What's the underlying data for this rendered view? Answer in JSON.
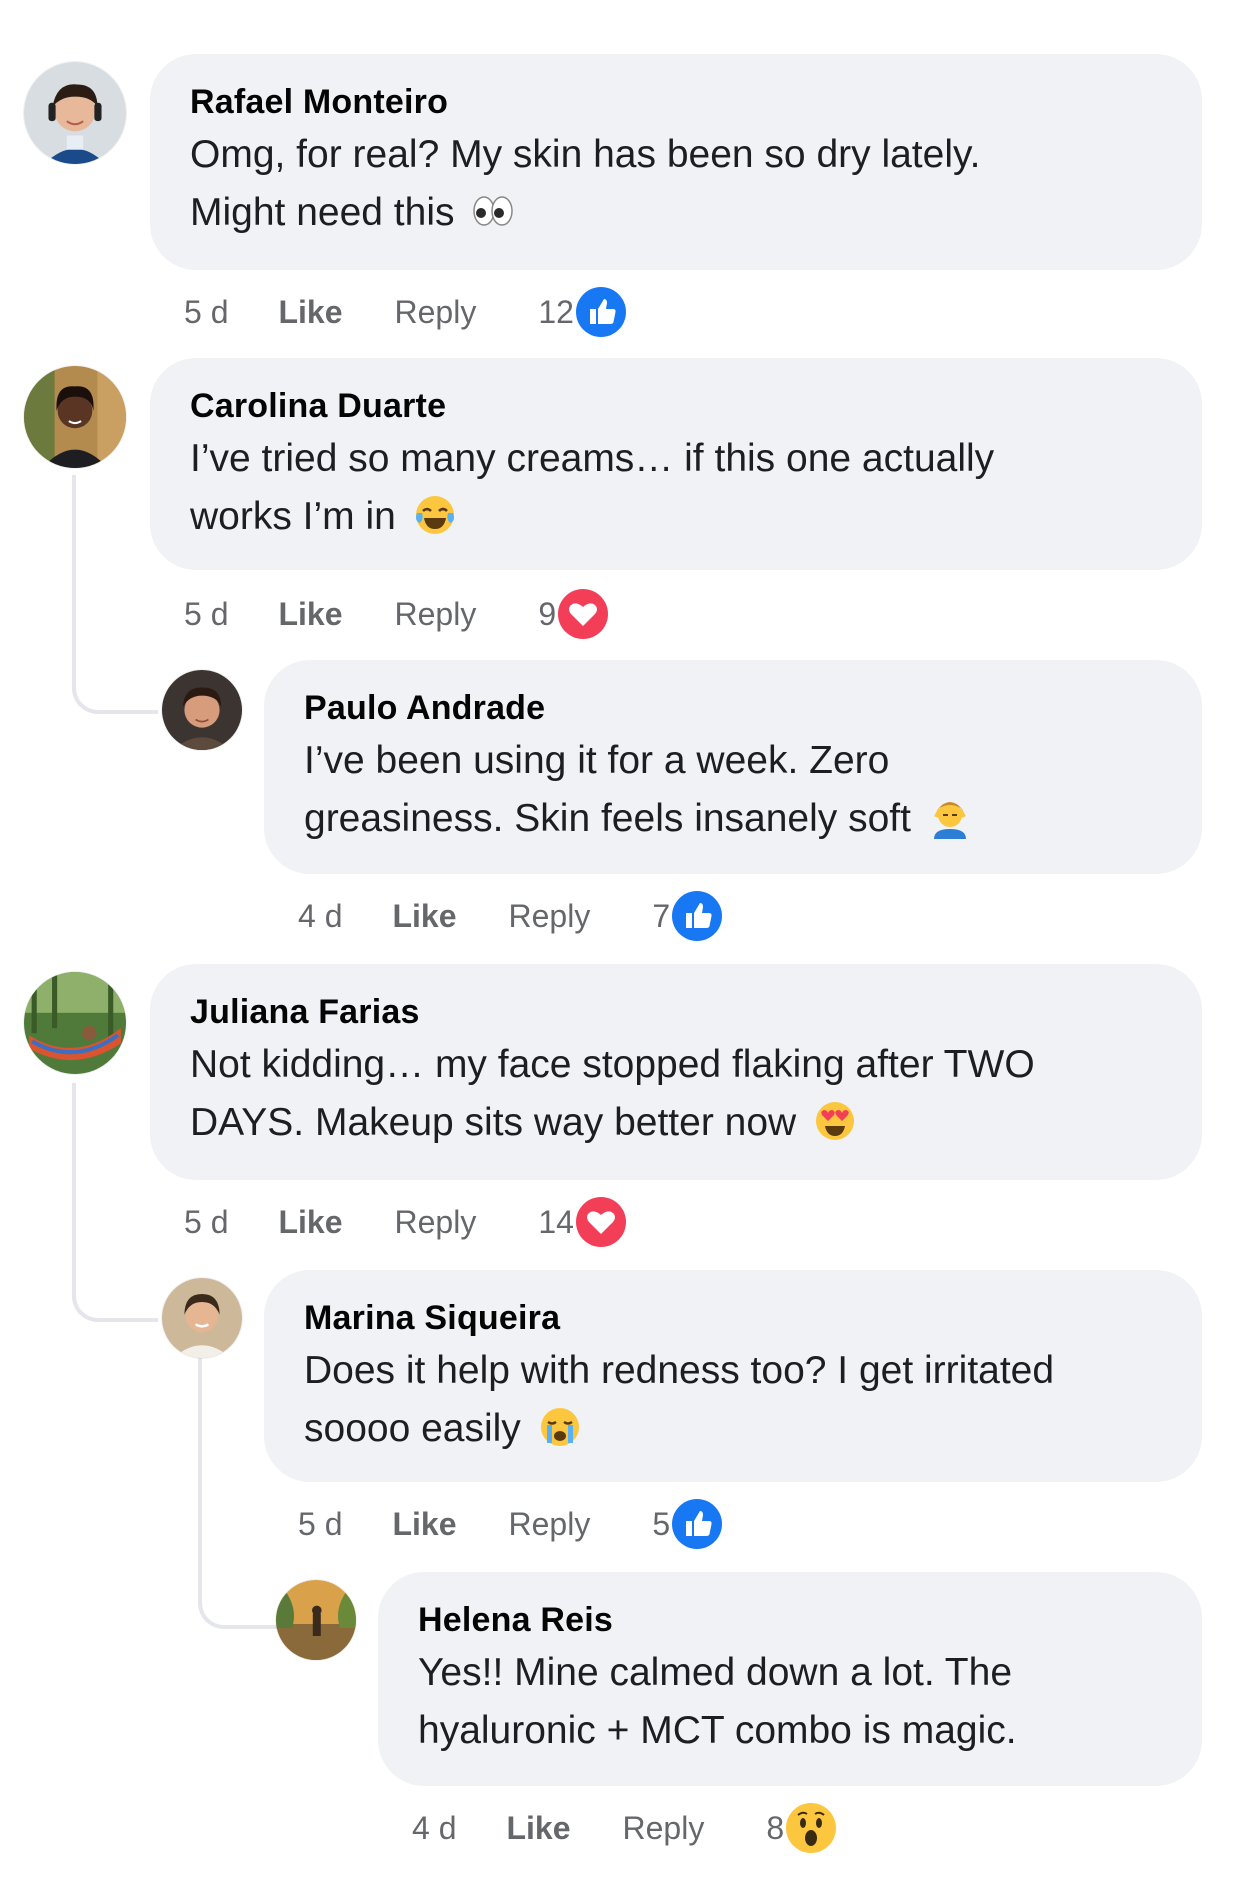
{
  "colors": {
    "bubble_bg": "#f0f2f5",
    "meta_text": "#65676b",
    "like_blue": "#1877f2",
    "love_red": "#f33e58",
    "wow_yellow": "#fcc63f"
  },
  "comments": [
    {
      "author": "Rafael Monteiro",
      "line1": "Omg, for real? My skin has been so dry lately.",
      "line2": "Might need this",
      "emoji": "eyes-emoji",
      "time": "5 d",
      "like_label": "Like",
      "reply_label": "Reply",
      "reaction_count": "12",
      "reaction": "like"
    },
    {
      "author": "Carolina Duarte",
      "line1": "I’ve tried so many creams… if this one actually",
      "line2": "works I’m in",
      "emoji": "tears-of-joy-emoji",
      "time": "5 d",
      "like_label": "Like",
      "reply_label": "Reply",
      "reaction_count": "9",
      "reaction": "love"
    },
    {
      "author": "Paulo Andrade",
      "line1": "I’ve been using it for a week. Zero",
      "line2": "greasiness. Skin feels insanely soft",
      "emoji": "face-massage-emoji",
      "time": "4 d",
      "like_label": "Like",
      "reply_label": "Reply",
      "reaction_count": "7",
      "reaction": "like"
    },
    {
      "author": "Juliana Farias",
      "line1": "Not kidding… my face stopped flaking after TWO",
      "line2": "DAYS. Makeup sits way better now",
      "emoji": "heart-eyes-emoji",
      "time": "5 d",
      "like_label": "Like",
      "reply_label": "Reply",
      "reaction_count": "14",
      "reaction": "love"
    },
    {
      "author": "Marina Siqueira",
      "line1": "Does it help with redness too? I get irritated",
      "line2": "soooo easily",
      "emoji": "crying-emoji",
      "time": "5 d",
      "like_label": "Like",
      "reply_label": "Reply",
      "reaction_count": "5",
      "reaction": "like"
    },
    {
      "author": "Helena Reis",
      "line1": "Yes!! Mine calmed down a lot. The",
      "line2": "hyaluronic + MCT combo is magic.",
      "emoji": "",
      "time": "4 d",
      "like_label": "Like",
      "reply_label": "Reply",
      "reaction_count": "8",
      "reaction": "wow"
    }
  ]
}
